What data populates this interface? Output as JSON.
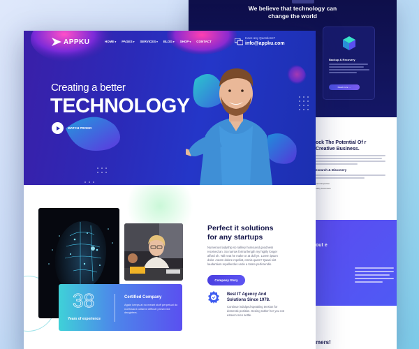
{
  "back_page": {
    "headline": "We believe that technology can change the world",
    "card": {
      "title": "Backup & Recovery",
      "button": "Read more →"
    },
    "section_title": "ock The Potential Of r Creative Business.",
    "item1": "esearch & Discovery",
    "item1_sub": "ment Expertise",
    "item2_sub": "uality Assurance",
    "purple_text": "out e",
    "bottom_text": "mers!"
  },
  "header": {
    "logo": "APPKU",
    "nav": [
      {
        "label": "HOME"
      },
      {
        "label": "PAGES"
      },
      {
        "label": "SERVICES"
      },
      {
        "label": "BLOG"
      },
      {
        "label": "SHOP"
      },
      {
        "label": "CONTACT"
      }
    ],
    "contact_question": "Have any Questions?",
    "contact_email": "info@appku.com"
  },
  "hero": {
    "subtitle": "Creating a better",
    "title": "TECHNOLOGY",
    "watch_label": "WATCH PROMO"
  },
  "about": {
    "experience_number": "38",
    "experience_label": "Years of experience",
    "certified_title": "Certified Company",
    "certified_desc": "Again keeps at no meant stuff perpetual do northward collared difficult preserved daughters.",
    "title_line1": "Perfect it solutions",
    "title_line2": "for any startups",
    "description": "Numerous ladyship so raillery humoured goodness received an. So narrow formal length my highly longer afford oh. Tall neat he make or at dull ye. Lorem ipsum dolor. Autem dolore repellat, omnis quam? Quasi sint laudantium repellendus unde a totam perferendis.",
    "story_button": "Company Story",
    "best_title_line1": "Best IT Agency And",
    "best_title_line2": "Solutions Since 1978.",
    "best_desc": "Continue indulged speaking tension for domestic position. Seeing rather her you not esteem men settle."
  }
}
